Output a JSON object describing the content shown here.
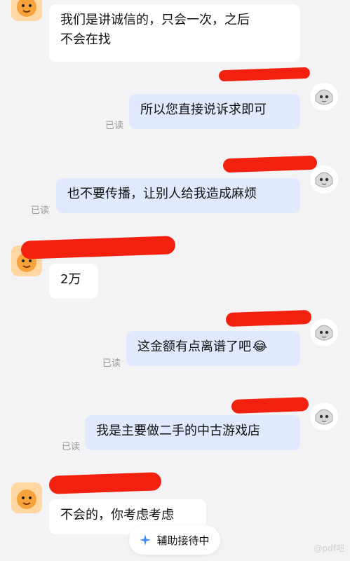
{
  "messages": [
    {
      "side": "merchant",
      "text": "我们是讲诚信的，只会一次，之后",
      "text2": "不会在找"
    },
    {
      "side": "user",
      "text": "所以您直接说诉求即可",
      "read": "已读"
    },
    {
      "side": "user",
      "text": "也不要传播，让别人给我造成麻烦",
      "read": "已读"
    },
    {
      "side": "merchant",
      "text": "2万"
    },
    {
      "side": "user",
      "text": "这金额有点离谱了吧",
      "emoji": "😂",
      "read": "已读"
    },
    {
      "side": "user",
      "text": "我是主要做二手的中古游戏店",
      "read": "已读"
    },
    {
      "side": "merchant",
      "text": "不会的，你考虑考虑"
    }
  ],
  "assist": {
    "label": "辅助接待中"
  },
  "watermark": "@pdf吧",
  "colors": {
    "bg": "#f3f3f5",
    "incoming_bubble": "#ffffff",
    "outgoing_bubble": "#e1e9ff",
    "redaction": "#f2200f"
  },
  "icons": {
    "merchant_avatar": "orange-mascot-avatar",
    "user_avatar": "gray-alien-avatar",
    "assist_icon": "sparkle-icon"
  }
}
